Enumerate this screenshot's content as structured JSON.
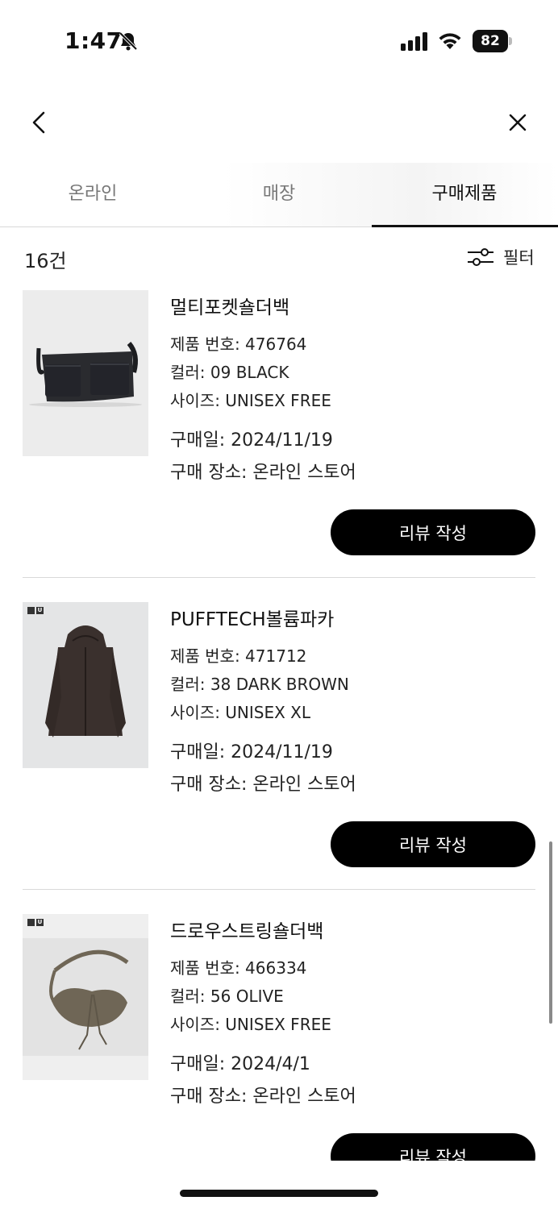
{
  "status_bar": {
    "time": "1:47",
    "battery": "82"
  },
  "tabs": [
    {
      "label": "온라인"
    },
    {
      "label": "매장"
    },
    {
      "label": "구매제품"
    }
  ],
  "count_label": "16건",
  "filter_label": "필터",
  "products": [
    {
      "name": "멀티포켓숄더백",
      "product_no": "제품 번호: 476764",
      "color": "컬러: 09 BLACK",
      "size": "사이즈: UNISEX FREE",
      "purchase_date": "구매일: 2024/11/19",
      "purchase_place": "구매 장소: 온라인 스토어",
      "review_label": "리뷰 작성"
    },
    {
      "name": "PUFFTECH볼륨파카",
      "product_no": "제품 번호: 471712",
      "color": "컬러: 38 DARK BROWN",
      "size": "사이즈: UNISEX XL",
      "purchase_date": "구매일: 2024/11/19",
      "purchase_place": "구매 장소: 온라인 스토어",
      "review_label": "리뷰 작성"
    },
    {
      "name": "드로우스트링숄더백",
      "product_no": "제품 번호: 466334",
      "color": "컬러: 56 OLIVE",
      "size": "사이즈: UNISEX FREE",
      "purchase_date": "구매일: 2024/4/1",
      "purchase_place": "구매 장소: 온라인 스토어",
      "review_label": "리뷰 작성"
    }
  ],
  "colors": {
    "button_bg": "#000000",
    "tab_active": "#111111",
    "tab_inactive": "#777777"
  },
  "icons": [
    "bell-slash-icon",
    "signal-icon",
    "wifi-icon",
    "battery-icon",
    "chevron-left-icon",
    "close-icon",
    "filter-sliders-icon"
  ]
}
